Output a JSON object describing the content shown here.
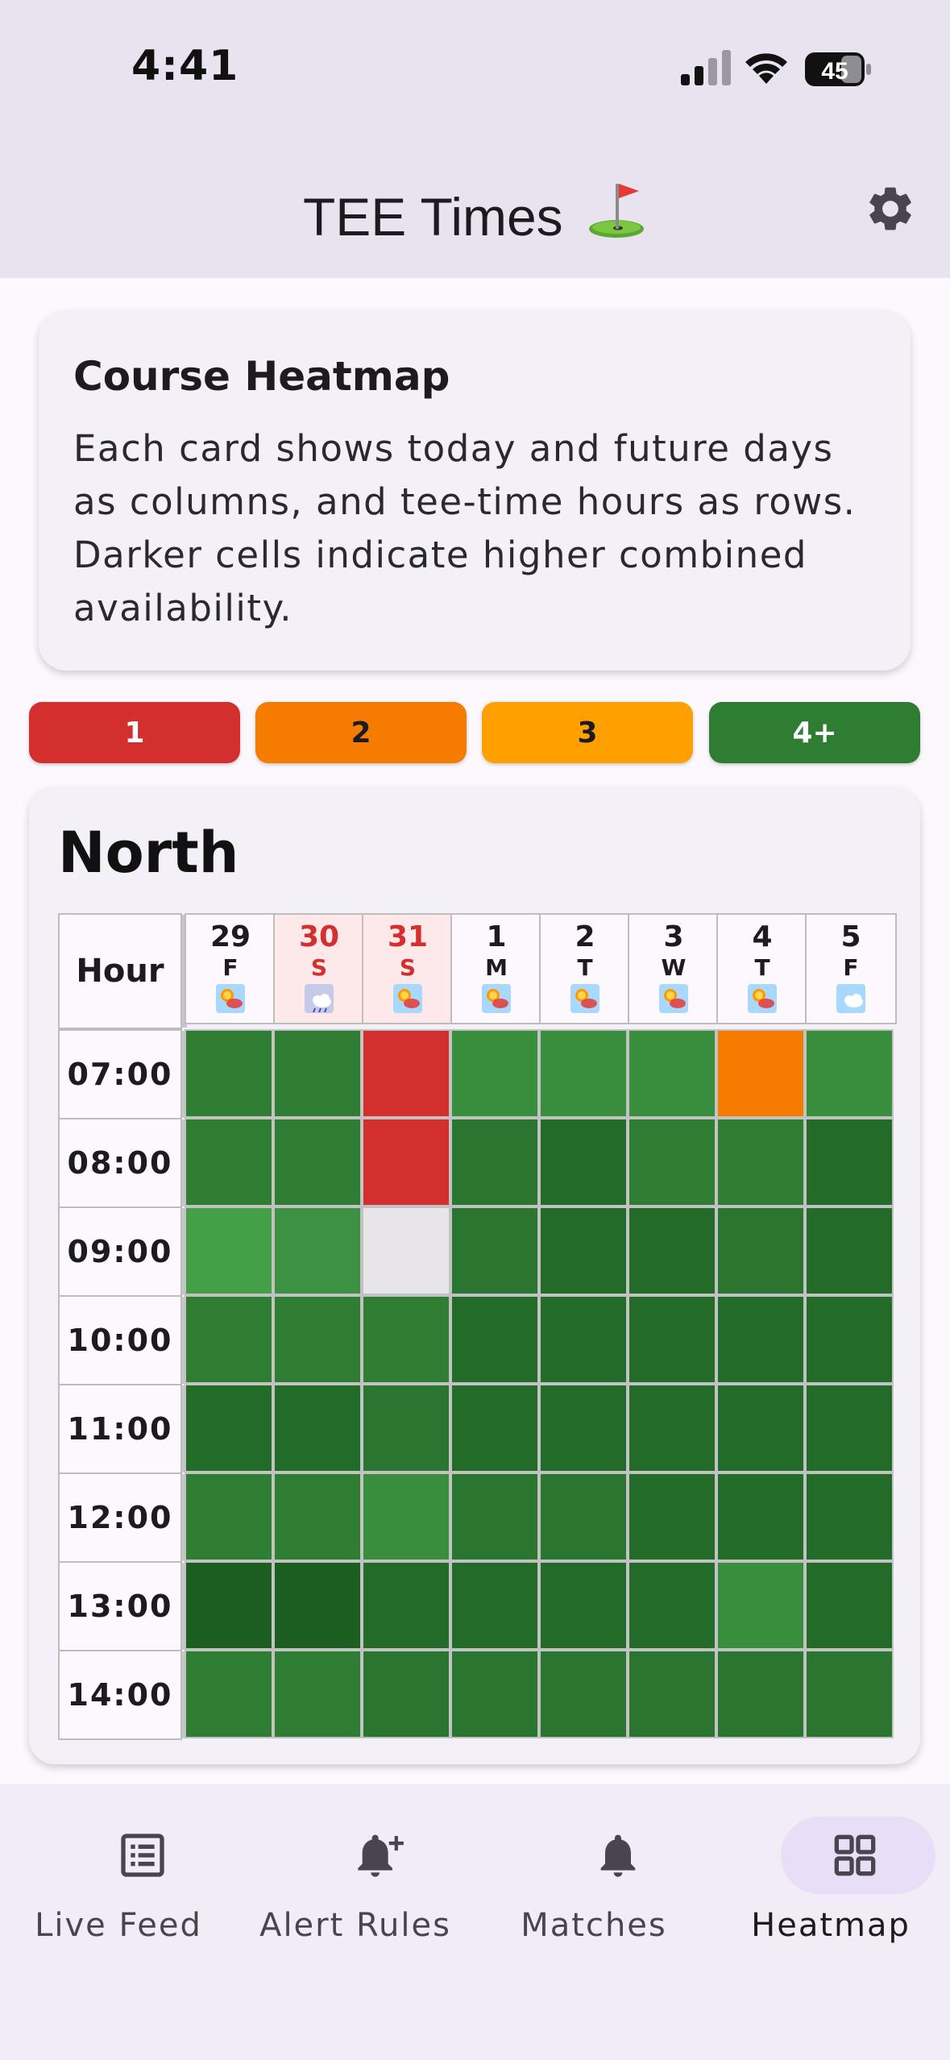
{
  "status": {
    "time": "4:41",
    "battery": "45"
  },
  "app_bar": {
    "title": "TEE Times",
    "settings_icon": "gear-icon",
    "title_icon": "golf-flag-icon"
  },
  "info_card": {
    "title": "Course Heatmap",
    "body": "Each card shows today and future days as columns, and tee-time hours as rows. Darker cells indicate higher combined availability."
  },
  "legend": [
    {
      "label": "1",
      "color": "#d32f2f",
      "text_color": "#ffffff"
    },
    {
      "label": "2",
      "color": "#f57c00",
      "text_color": "#1d1b20"
    },
    {
      "label": "3",
      "color": "#ffa000",
      "text_color": "#1d1b20"
    },
    {
      "label": "4+",
      "color": "#2e7d32",
      "text_color": "#ffffff"
    }
  ],
  "course": {
    "name": "North",
    "hour_header": "Hour",
    "days": [
      {
        "num": "29",
        "letter": "F",
        "weekend": false,
        "weather": "sun-cloud"
      },
      {
        "num": "30",
        "letter": "S",
        "weekend": true,
        "weather": "cloud-rain"
      },
      {
        "num": "31",
        "letter": "S",
        "weekend": true,
        "weather": "sun-cloud"
      },
      {
        "num": "1",
        "letter": "M",
        "weekend": false,
        "weather": "sun-cloud"
      },
      {
        "num": "2",
        "letter": "T",
        "weekend": false,
        "weather": "sun-cloud"
      },
      {
        "num": "3",
        "letter": "W",
        "weekend": false,
        "weather": "sun-cloud"
      },
      {
        "num": "4",
        "letter": "T",
        "weekend": false,
        "weather": "sun-cloud"
      },
      {
        "num": "5",
        "letter": "F",
        "weekend": false,
        "weather": "cloud"
      }
    ],
    "hours": [
      "07:00",
      "08:00",
      "09:00",
      "10:00",
      "11:00",
      "12:00",
      "13:00",
      "14:00"
    ],
    "cells": [
      [
        "#2e7d32",
        "#2e7d32",
        "#d32f2f",
        "#388e3c",
        "#388e3c",
        "#388e3c",
        "#f57c00",
        "#388e3c"
      ],
      [
        "#2e7d32",
        "#2e7d32",
        "#d32f2f",
        "#2a7530",
        "#236b29",
        "#2e7d32",
        "#2e7d32",
        "#236b29"
      ],
      [
        "#43a047",
        "#3d9142",
        "#e7e5ea",
        "#2a7530",
        "#236b29",
        "#236b29",
        "#2a7530",
        "#236b29"
      ],
      [
        "#2e7d32",
        "#2e7d32",
        "#2e7d32",
        "#236b29",
        "#236b29",
        "#236b29",
        "#236b29",
        "#236b29"
      ],
      [
        "#236b29",
        "#236b29",
        "#2a7530",
        "#236b29",
        "#236b29",
        "#236b29",
        "#236b29",
        "#236b29"
      ],
      [
        "#2e7d32",
        "#2e7d32",
        "#388e3c",
        "#2a7530",
        "#2a7530",
        "#236b29",
        "#236b29",
        "#236b29"
      ],
      [
        "#1b5e20",
        "#1b5e20",
        "#236b29",
        "#236b29",
        "#236b29",
        "#236b29",
        "#388e3c",
        "#236b29"
      ],
      [
        "#2e7d32",
        "#2e7d32",
        "#2a7530",
        "#2a7530",
        "#2a7530",
        "#2a7530",
        "#2a7530",
        "#2a7530"
      ]
    ]
  },
  "nav": [
    {
      "label": "Live Feed",
      "icon": "list-icon",
      "active": false
    },
    {
      "label": "Alert Rules",
      "icon": "bell-plus-icon",
      "active": false
    },
    {
      "label": "Matches",
      "icon": "bell-icon",
      "active": false
    },
    {
      "label": "Heatmap",
      "icon": "grid-icon",
      "active": true
    }
  ],
  "colors": {
    "weekend_text": "#d32f2f",
    "weekend_bg": "#fde8ea",
    "active_pill": "#e8def8",
    "active_label": "#1d1b20"
  }
}
